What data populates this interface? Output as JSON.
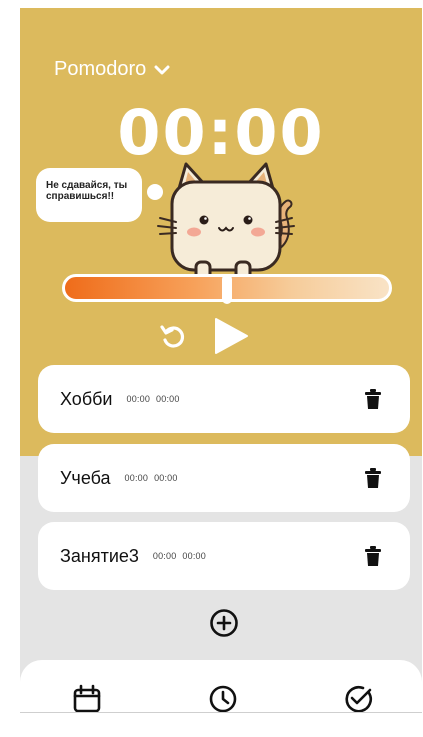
{
  "header": {
    "mode_label": "Pomodoro",
    "timer": "00:00"
  },
  "mascot": {
    "speech": "Не сдавайся, ты справишься!!"
  },
  "progress": {
    "fraction": 0.5
  },
  "tasks": [
    {
      "name": "Хобби",
      "start": "00:00",
      "end": "00:00"
    },
    {
      "name": "Учеба",
      "start": "00:00",
      "end": "00:00"
    },
    {
      "name": "Занятие3",
      "start": "00:00",
      "end": "00:00"
    }
  ],
  "icons": {
    "mode": "chevron-down-icon",
    "reset": "reset-icon",
    "play": "play-icon",
    "delete": "trash-icon",
    "add": "plus-circle-icon",
    "tabs": [
      "calendar-icon",
      "clock-icon",
      "check-circle-icon"
    ]
  },
  "colors": {
    "hero_bg": "#dcba5d",
    "progress_start": "#ef6c1a",
    "progress_end": "#f9e3c6",
    "card_bg": "#ffffff",
    "page_bg": "#e4e4e4"
  }
}
